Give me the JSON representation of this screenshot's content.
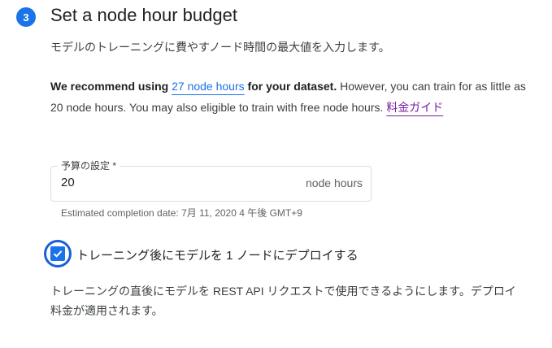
{
  "step": {
    "number": "3",
    "title": "Set a node hour budget",
    "subtitle": "モデルのトレーニングに費やすノード時間の最大値を入力します。"
  },
  "recommendation": {
    "bold_prefix": "We recommend using ",
    "link_text": "27 node hours",
    "bold_suffix": " for your dataset.",
    "rest_text": " However, you can train for as little as 20 node hours. You may also eligible to train with free node hours. ",
    "pricing_link": "料金ガイド"
  },
  "budget_field": {
    "label": "予算の設定 *",
    "value": "20",
    "suffix": "node hours"
  },
  "estimate_hint": "Estimated completion date: 7月 11, 2020 4 午後 GMT+9",
  "deploy_checkbox": {
    "checked": true,
    "label": "トレーニング後にモデルを 1 ノードにデプロイする"
  },
  "deploy_description": "トレーニングの直後にモデルを REST API リクエストで使用できるようにします。デプロイ料金が適用されます。",
  "colors": {
    "accent": "#1a73e8",
    "link_visited": "#7b1fa2",
    "focus_ring": "#1a5fd8"
  }
}
